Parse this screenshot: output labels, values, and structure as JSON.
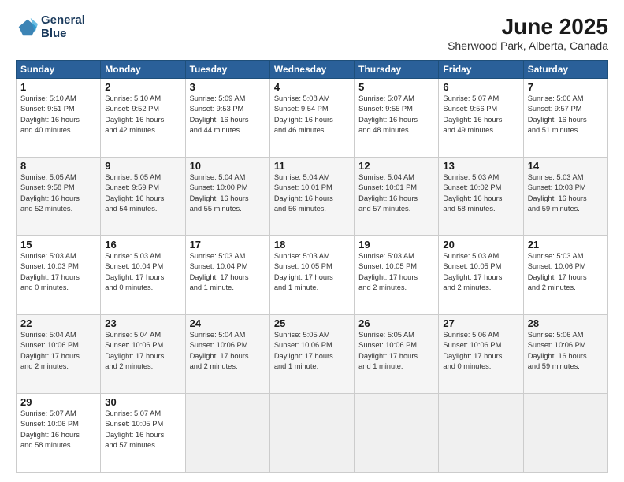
{
  "app": {
    "logo_line1": "General",
    "logo_line2": "Blue"
  },
  "header": {
    "title": "June 2025",
    "subtitle": "Sherwood Park, Alberta, Canada"
  },
  "days_of_week": [
    "Sunday",
    "Monday",
    "Tuesday",
    "Wednesday",
    "Thursday",
    "Friday",
    "Saturday"
  ],
  "weeks": [
    [
      {
        "day": "1",
        "info": "Sunrise: 5:10 AM\nSunset: 9:51 PM\nDaylight: 16 hours\nand 40 minutes."
      },
      {
        "day": "2",
        "info": "Sunrise: 5:10 AM\nSunset: 9:52 PM\nDaylight: 16 hours\nand 42 minutes."
      },
      {
        "day": "3",
        "info": "Sunrise: 5:09 AM\nSunset: 9:53 PM\nDaylight: 16 hours\nand 44 minutes."
      },
      {
        "day": "4",
        "info": "Sunrise: 5:08 AM\nSunset: 9:54 PM\nDaylight: 16 hours\nand 46 minutes."
      },
      {
        "day": "5",
        "info": "Sunrise: 5:07 AM\nSunset: 9:55 PM\nDaylight: 16 hours\nand 48 minutes."
      },
      {
        "day": "6",
        "info": "Sunrise: 5:07 AM\nSunset: 9:56 PM\nDaylight: 16 hours\nand 49 minutes."
      },
      {
        "day": "7",
        "info": "Sunrise: 5:06 AM\nSunset: 9:57 PM\nDaylight: 16 hours\nand 51 minutes."
      }
    ],
    [
      {
        "day": "8",
        "info": "Sunrise: 5:05 AM\nSunset: 9:58 PM\nDaylight: 16 hours\nand 52 minutes."
      },
      {
        "day": "9",
        "info": "Sunrise: 5:05 AM\nSunset: 9:59 PM\nDaylight: 16 hours\nand 54 minutes."
      },
      {
        "day": "10",
        "info": "Sunrise: 5:04 AM\nSunset: 10:00 PM\nDaylight: 16 hours\nand 55 minutes."
      },
      {
        "day": "11",
        "info": "Sunrise: 5:04 AM\nSunset: 10:01 PM\nDaylight: 16 hours\nand 56 minutes."
      },
      {
        "day": "12",
        "info": "Sunrise: 5:04 AM\nSunset: 10:01 PM\nDaylight: 16 hours\nand 57 minutes."
      },
      {
        "day": "13",
        "info": "Sunrise: 5:03 AM\nSunset: 10:02 PM\nDaylight: 16 hours\nand 58 minutes."
      },
      {
        "day": "14",
        "info": "Sunrise: 5:03 AM\nSunset: 10:03 PM\nDaylight: 16 hours\nand 59 minutes."
      }
    ],
    [
      {
        "day": "15",
        "info": "Sunrise: 5:03 AM\nSunset: 10:03 PM\nDaylight: 17 hours\nand 0 minutes."
      },
      {
        "day": "16",
        "info": "Sunrise: 5:03 AM\nSunset: 10:04 PM\nDaylight: 17 hours\nand 0 minutes."
      },
      {
        "day": "17",
        "info": "Sunrise: 5:03 AM\nSunset: 10:04 PM\nDaylight: 17 hours\nand 1 minute."
      },
      {
        "day": "18",
        "info": "Sunrise: 5:03 AM\nSunset: 10:05 PM\nDaylight: 17 hours\nand 1 minute."
      },
      {
        "day": "19",
        "info": "Sunrise: 5:03 AM\nSunset: 10:05 PM\nDaylight: 17 hours\nand 2 minutes."
      },
      {
        "day": "20",
        "info": "Sunrise: 5:03 AM\nSunset: 10:05 PM\nDaylight: 17 hours\nand 2 minutes."
      },
      {
        "day": "21",
        "info": "Sunrise: 5:03 AM\nSunset: 10:06 PM\nDaylight: 17 hours\nand 2 minutes."
      }
    ],
    [
      {
        "day": "22",
        "info": "Sunrise: 5:04 AM\nSunset: 10:06 PM\nDaylight: 17 hours\nand 2 minutes."
      },
      {
        "day": "23",
        "info": "Sunrise: 5:04 AM\nSunset: 10:06 PM\nDaylight: 17 hours\nand 2 minutes."
      },
      {
        "day": "24",
        "info": "Sunrise: 5:04 AM\nSunset: 10:06 PM\nDaylight: 17 hours\nand 2 minutes."
      },
      {
        "day": "25",
        "info": "Sunrise: 5:05 AM\nSunset: 10:06 PM\nDaylight: 17 hours\nand 1 minute."
      },
      {
        "day": "26",
        "info": "Sunrise: 5:05 AM\nSunset: 10:06 PM\nDaylight: 17 hours\nand 1 minute."
      },
      {
        "day": "27",
        "info": "Sunrise: 5:06 AM\nSunset: 10:06 PM\nDaylight: 17 hours\nand 0 minutes."
      },
      {
        "day": "28",
        "info": "Sunrise: 5:06 AM\nSunset: 10:06 PM\nDaylight: 16 hours\nand 59 minutes."
      }
    ],
    [
      {
        "day": "29",
        "info": "Sunrise: 5:07 AM\nSunset: 10:06 PM\nDaylight: 16 hours\nand 58 minutes."
      },
      {
        "day": "30",
        "info": "Sunrise: 5:07 AM\nSunset: 10:05 PM\nDaylight: 16 hours\nand 57 minutes."
      },
      {
        "day": "",
        "info": ""
      },
      {
        "day": "",
        "info": ""
      },
      {
        "day": "",
        "info": ""
      },
      {
        "day": "",
        "info": ""
      },
      {
        "day": "",
        "info": ""
      }
    ]
  ]
}
